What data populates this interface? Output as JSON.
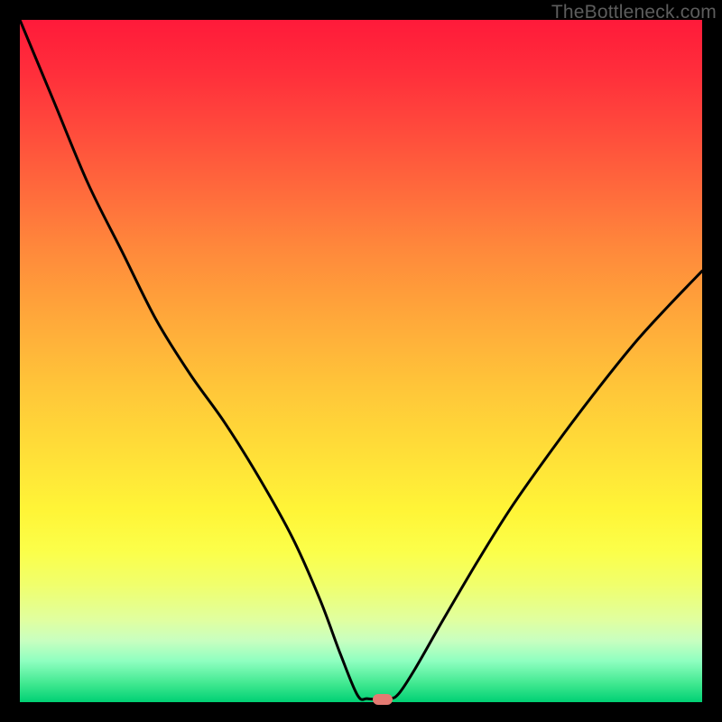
{
  "watermark": "TheBottleneck.com",
  "marker": {
    "x_frac": 0.532,
    "y_frac": 0.996
  },
  "chart_data": {
    "type": "line",
    "title": "",
    "xlabel": "",
    "ylabel": "",
    "xlim": [
      0,
      1
    ],
    "ylim": [
      0,
      1
    ],
    "series": [
      {
        "name": "bottleneck-curve",
        "x": [
          0.0,
          0.05,
          0.1,
          0.15,
          0.2,
          0.25,
          0.3,
          0.35,
          0.4,
          0.44,
          0.47,
          0.495,
          0.51,
          0.54,
          0.555,
          0.58,
          0.62,
          0.67,
          0.72,
          0.78,
          0.84,
          0.9,
          0.95,
          1.0
        ],
        "y": [
          1.0,
          0.88,
          0.76,
          0.66,
          0.56,
          0.48,
          0.41,
          0.33,
          0.24,
          0.15,
          0.07,
          0.01,
          0.005,
          0.005,
          0.012,
          0.05,
          0.12,
          0.205,
          0.285,
          0.37,
          0.45,
          0.525,
          0.58,
          0.632
        ]
      }
    ],
    "annotations": [
      {
        "type": "marker",
        "x": 0.532,
        "y": 0.004,
        "color": "#e47a72"
      }
    ],
    "background_gradient": {
      "top_color": "#ff1a3a",
      "mid_color": "#ffe038",
      "bottom_color": "#00d074"
    }
  }
}
